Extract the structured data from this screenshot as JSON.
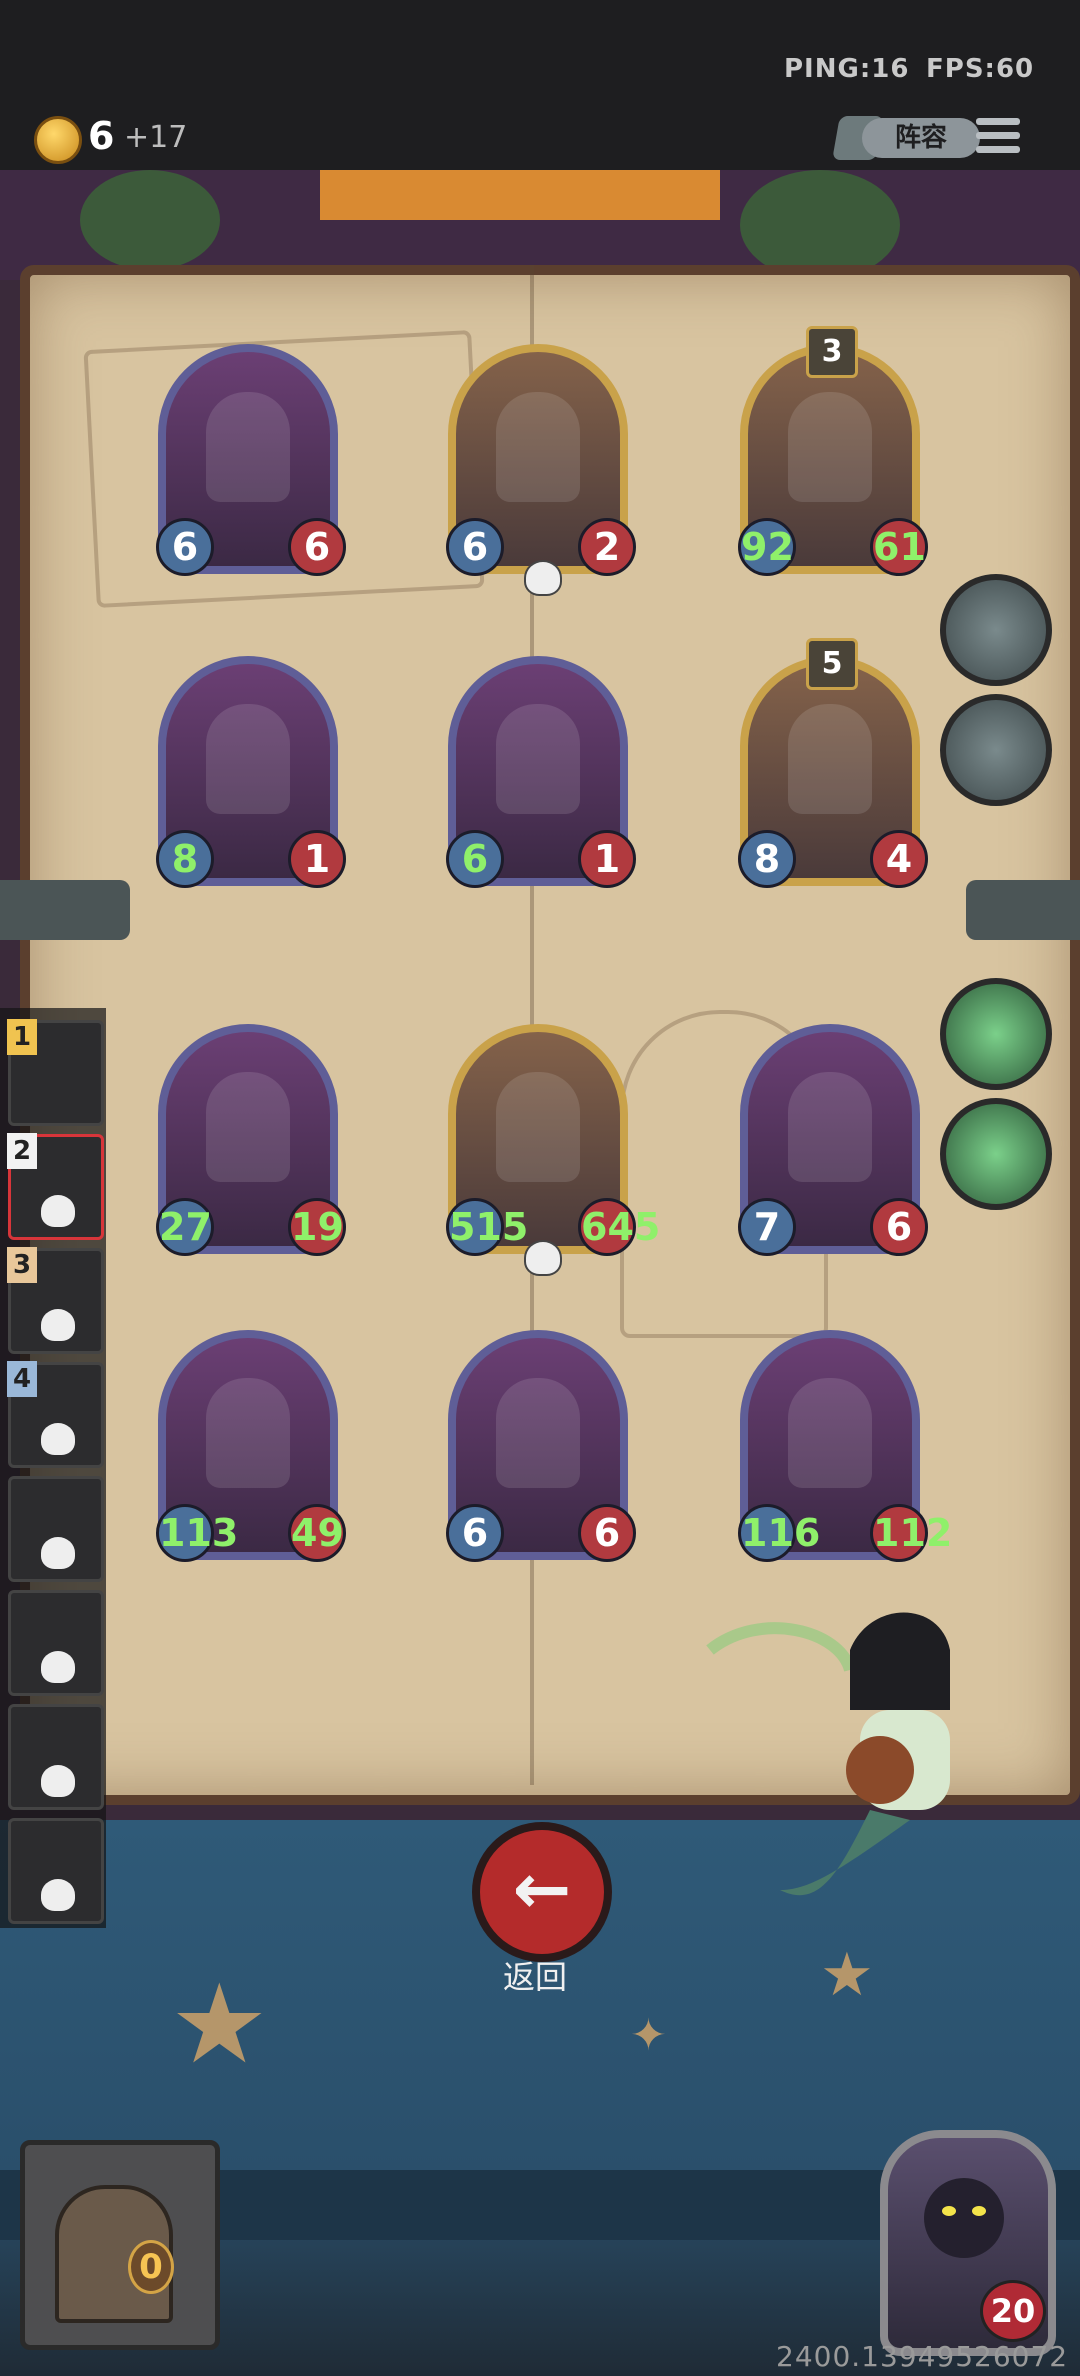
{
  "topbar": {
    "ping_label": "PING:16",
    "fps_label": "FPS:60",
    "gold_amount": "6",
    "gold_income": "+17",
    "lineup_button": "阵容",
    "menu_icon": "menu-icon"
  },
  "board": {
    "cards": [
      {
        "atk": "6",
        "hp": "6",
        "atk_buffed": false,
        "hp_buffed": false,
        "gold": false
      },
      {
        "atk": "6",
        "hp": "2",
        "atk_buffed": false,
        "hp_buffed": false,
        "gold": true,
        "skull": true
      },
      {
        "atk": "92",
        "hp": "61",
        "atk_buffed": true,
        "hp_buffed": true,
        "gold": true,
        "level": "3"
      },
      {
        "atk": "8",
        "hp": "1",
        "atk_buffed": true,
        "hp_buffed": false,
        "gold": false
      },
      {
        "atk": "6",
        "hp": "1",
        "atk_buffed": true,
        "hp_buffed": false,
        "gold": false
      },
      {
        "atk": "8",
        "hp": "4",
        "atk_buffed": false,
        "hp_buffed": false,
        "gold": true,
        "level": "5"
      },
      {
        "atk": "27",
        "hp": "19",
        "atk_buffed": true,
        "hp_buffed": true,
        "gold": false
      },
      {
        "atk": "515",
        "hp": "645",
        "atk_buffed": true,
        "hp_buffed": true,
        "gold": true,
        "skull": true
      },
      {
        "atk": "7",
        "hp": "6",
        "atk_buffed": false,
        "hp_buffed": false,
        "gold": false
      },
      {
        "atk": "113",
        "hp": "49",
        "atk_buffed": true,
        "hp_buffed": true,
        "gold": false
      },
      {
        "atk": "6",
        "hp": "6",
        "atk_buffed": false,
        "hp_buffed": false,
        "gold": false
      },
      {
        "atk": "116",
        "hp": "112",
        "atk_buffed": true,
        "hp_buffed": true,
        "gold": false
      }
    ]
  },
  "opponents": [
    {
      "rank": "1"
    },
    {
      "rank": "2"
    },
    {
      "rank": "3"
    },
    {
      "rank": "4"
    },
    {
      "rank": ""
    },
    {
      "rank": ""
    },
    {
      "rank": ""
    },
    {
      "rank": ""
    }
  ],
  "back_button": {
    "label": "返回",
    "icon": "arrow-left-icon"
  },
  "treasure_count": "0",
  "hero_hp": "20",
  "footer_id": "2400.13949526072",
  "colors": {
    "atk": "#4a6f9a",
    "hp": "#b13a3f",
    "buffed": "#8ff06a",
    "gold_frame": "#c9a24a"
  }
}
